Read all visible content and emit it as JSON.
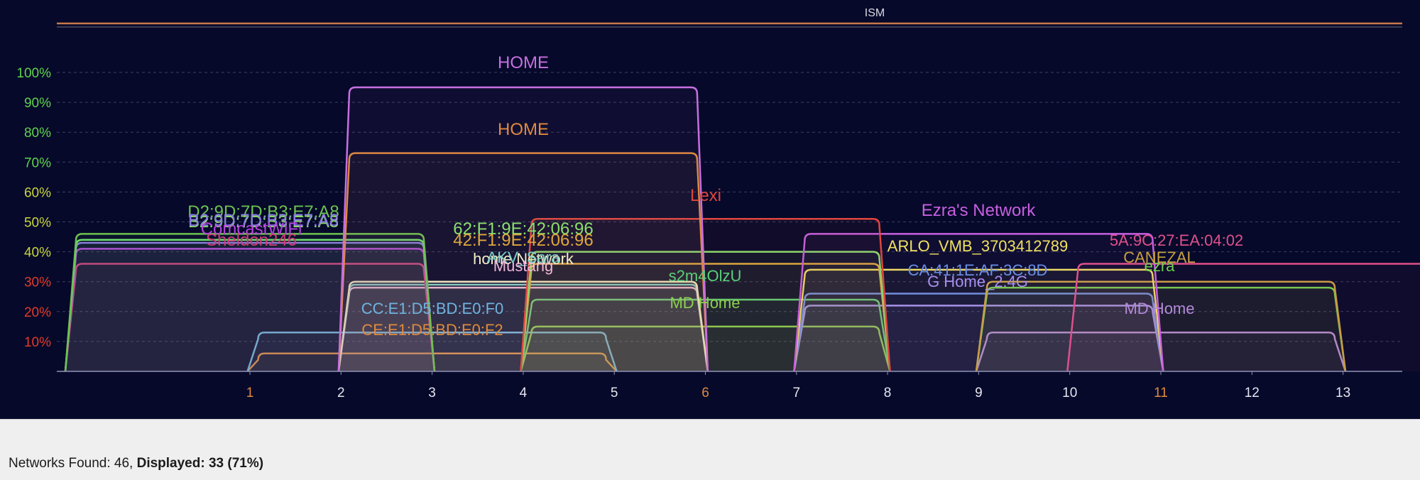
{
  "chart_data": {
    "type": "area",
    "title": "ISM",
    "ylim": [
      0,
      100
    ],
    "y_ticks": [
      "100%",
      "90%",
      "80%",
      "70%",
      "60%",
      "50%",
      "40%",
      "30%",
      "20%",
      "10%"
    ],
    "x_ticks": [
      "1",
      "2",
      "3",
      "4",
      "5",
      "6",
      "7",
      "8",
      "9",
      "10",
      "11",
      "12",
      "13"
    ],
    "highlighted_channels": [
      "1",
      "6",
      "11"
    ],
    "grid": true,
    "colors": {
      "background": "#06092a",
      "axis": "#8f93b6",
      "band": "#c8794a",
      "tick_highlight": "#e08a3c",
      "tick_normal": "#e6e6f0",
      "grid": "#3a3f62"
    },
    "series": [
      {
        "name": "HOME",
        "channel": 4,
        "signal": 95,
        "color": "#c86fe0"
      },
      {
        "name": "HOME",
        "channel": 4,
        "signal": 73,
        "color": "#e0893c"
      },
      {
        "name": "Lexi",
        "channel": 6,
        "signal": 51,
        "color": "#e0463c"
      },
      {
        "name": "Ezra's Network",
        "channel": 9,
        "signal": 46,
        "color": "#c85fe0"
      },
      {
        "name": "D2:9D:7D:B3:E7:A8",
        "channel": 1,
        "signal": 46,
        "color": "#6cc24f"
      },
      {
        "name": "B2:9D:7D:B3:E7:A8",
        "channel": 1,
        "signal": 44,
        "color": "#6fe070"
      },
      {
        "name": "B2:9D:7D:B3:E7:A8",
        "channel": 1,
        "signal": 43,
        "color": "#8a78e6"
      },
      {
        "name": "ComcastWiFi",
        "channel": 1,
        "signal": 41,
        "color": "#b542dc"
      },
      {
        "name": "Sheldon246",
        "channel": 1,
        "signal": 36,
        "color": "#d23a7a"
      },
      {
        "name": "62:F1:9E:42:06:96",
        "channel": 6,
        "signal": 40,
        "color": "#8be06e"
      },
      {
        "name": "42:F1:9E:42:06:96",
        "channel": 6,
        "signal": 36,
        "color": "#e0a83c"
      },
      {
        "name": "home Network",
        "channel": 4,
        "signal": 30,
        "color": "#f4f0c8"
      },
      {
        "name": "AKV_Sara",
        "channel": 4,
        "signal": 29,
        "color": "#7ad0c8"
      },
      {
        "name": "Mustang",
        "channel": 4,
        "signal": 28,
        "color": "#f0b8d8"
      },
      {
        "name": "s2m4OlzU",
        "channel": 6,
        "signal": 24,
        "color": "#5ad07a"
      },
      {
        "name": "MD Home",
        "channel": 6,
        "signal": 15,
        "color": "#8ad04e"
      },
      {
        "name": "CC:E1:D5:BD:E0:F0",
        "channel": 3,
        "signal": 13,
        "color": "#6fb4e0"
      },
      {
        "name": "CE:E1:D5:BD:E0:F2",
        "channel": 3,
        "signal": 6,
        "color": "#e08a3c"
      },
      {
        "name": "ARLO_VMB_3703412789",
        "channel": 9,
        "signal": 34,
        "color": "#f0e060"
      },
      {
        "name": "CA:41:1E:AF:3C:8D",
        "channel": 9,
        "signal": 26,
        "color": "#6a8ee6"
      },
      {
        "name": "G Home_2.4G",
        "channel": 9,
        "signal": 22,
        "color": "#a890f0"
      },
      {
        "name": "5A:9C:27:EA:04:02",
        "channel": 12,
        "signal": 36,
        "color": "#e0508a"
      },
      {
        "name": "CANEZAL",
        "channel": 11,
        "signal": 30,
        "color": "#c8a040"
      },
      {
        "name": "ezra",
        "channel": 11,
        "signal": 28,
        "color": "#6ed04e"
      },
      {
        "name": "MD Home",
        "channel": 11,
        "signal": 13,
        "color": "#b48ad8"
      }
    ],
    "labels": [
      {
        "text": "HOME",
        "color": "#c86fe0"
      },
      {
        "text": "HOME",
        "color": "#e0893c"
      },
      {
        "text": "Lexi",
        "color": "#e0463c"
      },
      {
        "text": "Ezra's Network",
        "color": "#c85fe0"
      },
      {
        "text": "D2:9D:7D:B3:E7:A8",
        "color": "#6cc24f"
      },
      {
        "text": "B2:9D:7D:B3:E7:A8",
        "color": "#8fe070"
      },
      {
        "text": "B2:9D:7D:B3:E7:A8",
        "color": "#8a78e6"
      },
      {
        "text": "ComcastWiFi",
        "color": "#b542dc"
      },
      {
        "text": "Sheldon246",
        "color": "#d23a7a"
      },
      {
        "text": "62:F1:9E:42:06:96",
        "color": "#8be06e"
      },
      {
        "text": "42:F1:9E:42:06:96",
        "color": "#e0a83c"
      },
      {
        "text": "home Network",
        "color": "#f4f0c8"
      },
      {
        "text": "AKV_Sara",
        "color": "#7ad0c8"
      },
      {
        "text": "Mustang",
        "color": "#f0b8d8"
      },
      {
        "text": "s2m4OlzU",
        "color": "#5ad07a"
      },
      {
        "text": "MD Home",
        "color": "#8ad04e"
      },
      {
        "text": "CC:E1:D5:BD:E0:F0",
        "color": "#6fb4e0"
      },
      {
        "text": "CE:E1:D5:BD:E0:F2",
        "color": "#e08a3c"
      },
      {
        "text": "ARLO_VMB_3703412789",
        "color": "#f0e060"
      },
      {
        "text": "CA:41:1E:AF:3C:8D",
        "color": "#6a8ee6"
      },
      {
        "text": "G Home_2.4G",
        "color": "#a890f0"
      },
      {
        "text": "5A:9C:27:EA:04:02",
        "color": "#e0508a"
      },
      {
        "text": "CANEZAL",
        "color": "#c8a040"
      },
      {
        "text": "ezra",
        "color": "#6ed04e"
      },
      {
        "text": "MD Home",
        "color": "#b48ad8"
      }
    ]
  },
  "status": {
    "found_label": "Networks Found: 46, ",
    "displayed_label": "Displayed: 33 (71%)"
  }
}
